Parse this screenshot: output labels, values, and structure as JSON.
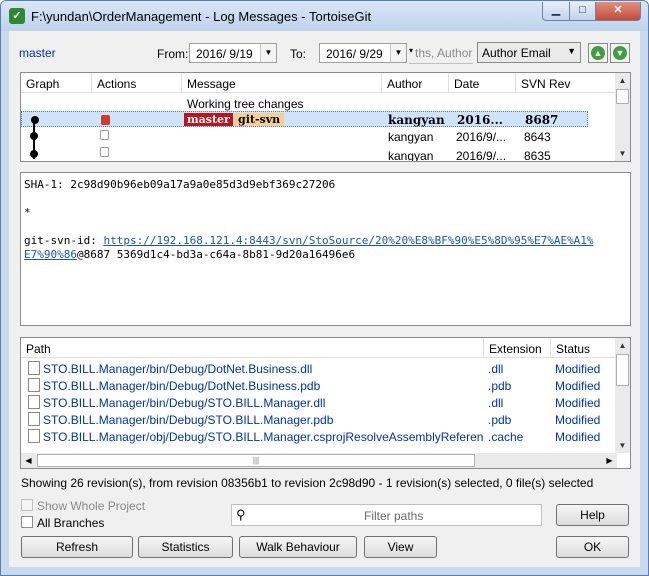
{
  "window": {
    "title": "F:\\yundan\\OrderManagement - Log Messages - TortoiseGit"
  },
  "toolbar": {
    "branch": "master",
    "from_label": "From:",
    "from_date": "2016/ 9/19",
    "to_label": "To:",
    "to_date": "2016/ 9/29",
    "search_placeholder": "ths, Authors",
    "filter_by": "Author Email"
  },
  "log": {
    "columns": [
      "Graph",
      "Actions",
      "Message",
      "Author",
      "Date",
      "SVN Rev"
    ],
    "rows": [
      {
        "message": "Working tree changes",
        "author": "",
        "date": "",
        "rev": ""
      },
      {
        "tags": [
          "master",
          "git-svn"
        ],
        "author": "kangyan",
        "date": "2016...",
        "rev": "8687"
      },
      {
        "message": "",
        "author": "kangyan",
        "date": "2016/9/...",
        "rev": "8643"
      },
      {
        "message": "",
        "author": "kangyan",
        "date": "2016/9/...",
        "rev": "8635"
      }
    ]
  },
  "details": {
    "sha": "SHA-1: 2c98d90b96eb09a17a9a0e85d3d9ebf369c27206",
    "star": "*",
    "svn_prefix": "git-svn-id: ",
    "svn_url_1": "https://192.168.121.4:8443/svn/StoSource/20%20%E8%BF%90%E5%8D%95%E7%AE%A1%",
    "svn_url_2": "E7%90%86",
    "svn_rest": "@8687 5369d1c4-bd3a-c64a-8b81-9d20a16496e6"
  },
  "files": {
    "columns": [
      "Path",
      "Extension",
      "Status"
    ],
    "rows": [
      {
        "path": "STO.BILL.Manager/bin/Debug/DotNet.Business.dll",
        "ext": ".dll",
        "status": "Modified"
      },
      {
        "path": "STO.BILL.Manager/bin/Debug/DotNet.Business.pdb",
        "ext": ".pdb",
        "status": "Modified"
      },
      {
        "path": "STO.BILL.Manager/bin/Debug/STO.BILL.Manager.dll",
        "ext": ".dll",
        "status": "Modified"
      },
      {
        "path": "STO.BILL.Manager/bin/Debug/STO.BILL.Manager.pdb",
        "ext": ".pdb",
        "status": "Modified"
      },
      {
        "path": "STO.BILL.Manager/obj/Debug/STO.BILL.Manager.csprojResolveAssemblyReference.cache",
        "ext": ".cache",
        "status": "Modified"
      }
    ]
  },
  "status_text": "Showing 26 revision(s), from revision 08356b1 to revision 2c98d90 - 1 revision(s) selected, 0 file(s) selected",
  "options": {
    "show_whole_project": "Show Whole Project",
    "all_branches": "All Branches"
  },
  "filter_paths_placeholder": "Filter paths",
  "buttons": {
    "help": "Help",
    "refresh": "Refresh",
    "statistics": "Statistics",
    "walk": "Walk Behaviour",
    "view": "View",
    "ok": "OK"
  },
  "colors": {
    "accent_link": "#0033aa",
    "tag_master": "#c0141c",
    "tag_gitsvn": "#f7cf8f",
    "selection": "#cfe3fb"
  }
}
